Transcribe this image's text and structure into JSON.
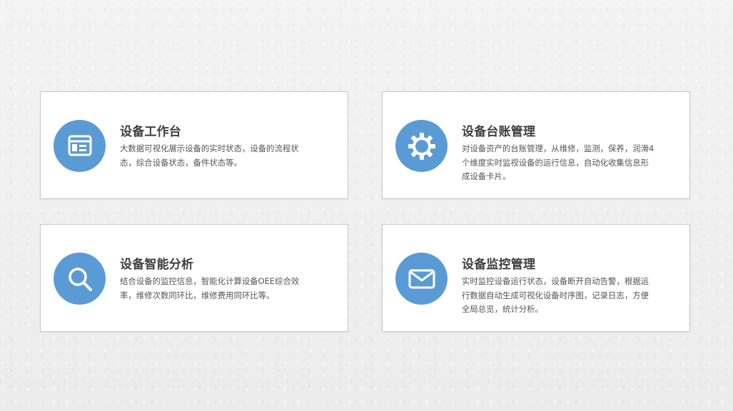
{
  "cards": [
    {
      "title": "设备工作台",
      "description": "大数据可视化展示设备的实时状态，设备的流程状态，综合设备状态，备件状态等。",
      "icon": "dashboard-window-icon"
    },
    {
      "title": "设备台账管理",
      "description": "对设备资产的台账管理，从维修，监测，保养，润滑4个维度实时监视设备的运行信息，自动化收集信息形成设备卡片。",
      "icon": "gear-icon"
    },
    {
      "title": "设备智能分析",
      "description": "结合设备的监控信息，智能化计算设备OEE综合效率，维修次数同环比，维修费用同环比等。",
      "icon": "search-icon"
    },
    {
      "title": "设备监控管理",
      "description": "实时监控设备运行状态，设备断开自动告警，根据运行数据自动生成可视化设备时序图，记录日志，方便全局总览，统计分析。",
      "icon": "mail-icon"
    }
  ],
  "colors": {
    "accent": "#5b9bd5",
    "background": "#efefef",
    "card": "#ffffff",
    "border": "#c8c8c8",
    "title": "#3f3f3f",
    "text": "#555555"
  }
}
